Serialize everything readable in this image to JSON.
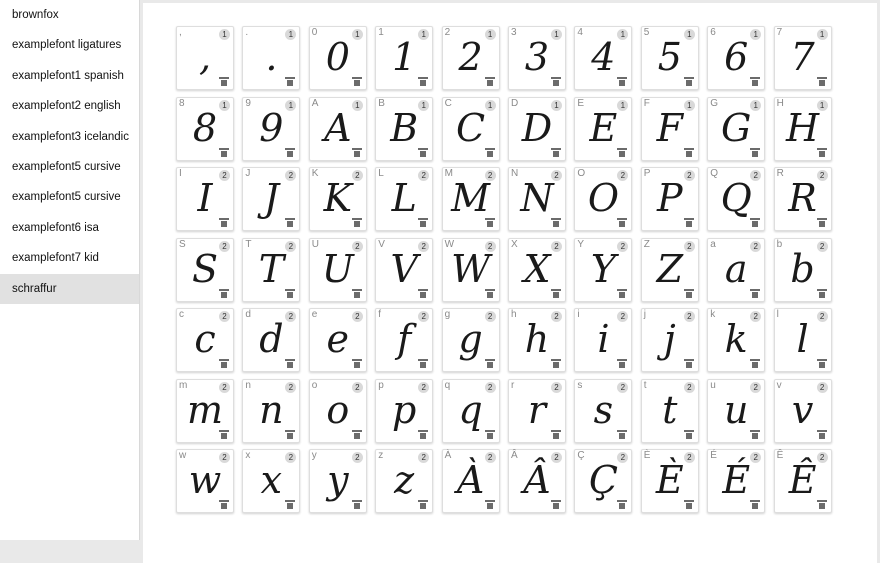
{
  "sidebar": {
    "items": [
      {
        "label": "brownfox",
        "selected": false
      },
      {
        "label": "examplefont ligatures",
        "selected": false
      },
      {
        "label": "examplefont1 spanish",
        "selected": false
      },
      {
        "label": "examplefont2 english",
        "selected": false
      },
      {
        "label": "examplefont3 icelandic",
        "selected": false
      },
      {
        "label": "examplefont5 cursive",
        "selected": false
      },
      {
        "label": "examplefont5 cursive",
        "selected": false
      },
      {
        "label": "examplefont6 isa",
        "selected": false
      },
      {
        "label": "examplefont7 kid",
        "selected": false
      },
      {
        "label": "schraffur",
        "selected": true
      }
    ]
  },
  "glyphs": [
    {
      "label": ",",
      "count": "1",
      "glyph": ","
    },
    {
      "label": ".",
      "count": "1",
      "glyph": "."
    },
    {
      "label": "0",
      "count": "1",
      "glyph": "0"
    },
    {
      "label": "1",
      "count": "1",
      "glyph": "1"
    },
    {
      "label": "2",
      "count": "1",
      "glyph": "2"
    },
    {
      "label": "3",
      "count": "1",
      "glyph": "3"
    },
    {
      "label": "4",
      "count": "1",
      "glyph": "4"
    },
    {
      "label": "5",
      "count": "1",
      "glyph": "5"
    },
    {
      "label": "6",
      "count": "1",
      "glyph": "6"
    },
    {
      "label": "7",
      "count": "1",
      "glyph": "7"
    },
    {
      "label": "8",
      "count": "1",
      "glyph": "8"
    },
    {
      "label": "9",
      "count": "1",
      "glyph": "9"
    },
    {
      "label": "A",
      "count": "1",
      "glyph": "A"
    },
    {
      "label": "B",
      "count": "1",
      "glyph": "B"
    },
    {
      "label": "C",
      "count": "1",
      "glyph": "C"
    },
    {
      "label": "D",
      "count": "1",
      "glyph": "D"
    },
    {
      "label": "E",
      "count": "1",
      "glyph": "E"
    },
    {
      "label": "F",
      "count": "1",
      "glyph": "F"
    },
    {
      "label": "G",
      "count": "1",
      "glyph": "G"
    },
    {
      "label": "H",
      "count": "1",
      "glyph": "H"
    },
    {
      "label": "I",
      "count": "2",
      "glyph": "I"
    },
    {
      "label": "J",
      "count": "2",
      "glyph": "J"
    },
    {
      "label": "K",
      "count": "2",
      "glyph": "K"
    },
    {
      "label": "L",
      "count": "2",
      "glyph": "L"
    },
    {
      "label": "M",
      "count": "2",
      "glyph": "M"
    },
    {
      "label": "N",
      "count": "2",
      "glyph": "N"
    },
    {
      "label": "O",
      "count": "2",
      "glyph": "O"
    },
    {
      "label": "P",
      "count": "2",
      "glyph": "P"
    },
    {
      "label": "Q",
      "count": "2",
      "glyph": "Q"
    },
    {
      "label": "R",
      "count": "2",
      "glyph": "R"
    },
    {
      "label": "S",
      "count": "2",
      "glyph": "S"
    },
    {
      "label": "T",
      "count": "2",
      "glyph": "T"
    },
    {
      "label": "U",
      "count": "2",
      "glyph": "U"
    },
    {
      "label": "V",
      "count": "2",
      "glyph": "V"
    },
    {
      "label": "W",
      "count": "2",
      "glyph": "W"
    },
    {
      "label": "X",
      "count": "2",
      "glyph": "X"
    },
    {
      "label": "Y",
      "count": "2",
      "glyph": "Y"
    },
    {
      "label": "Z",
      "count": "2",
      "glyph": "Z"
    },
    {
      "label": "a",
      "count": "2",
      "glyph": "a"
    },
    {
      "label": "b",
      "count": "2",
      "glyph": "b"
    },
    {
      "label": "c",
      "count": "2",
      "glyph": "c"
    },
    {
      "label": "d",
      "count": "2",
      "glyph": "d"
    },
    {
      "label": "e",
      "count": "2",
      "glyph": "e"
    },
    {
      "label": "f",
      "count": "2",
      "glyph": "f"
    },
    {
      "label": "g",
      "count": "2",
      "glyph": "g"
    },
    {
      "label": "h",
      "count": "2",
      "glyph": "h"
    },
    {
      "label": "i",
      "count": "2",
      "glyph": "i"
    },
    {
      "label": "j",
      "count": "2",
      "glyph": "j"
    },
    {
      "label": "k",
      "count": "2",
      "glyph": "k"
    },
    {
      "label": "l",
      "count": "2",
      "glyph": "l"
    },
    {
      "label": "m",
      "count": "2",
      "glyph": "m"
    },
    {
      "label": "n",
      "count": "2",
      "glyph": "n"
    },
    {
      "label": "o",
      "count": "2",
      "glyph": "o"
    },
    {
      "label": "p",
      "count": "2",
      "glyph": "p"
    },
    {
      "label": "q",
      "count": "2",
      "glyph": "q"
    },
    {
      "label": "r",
      "count": "2",
      "glyph": "r"
    },
    {
      "label": "s",
      "count": "2",
      "glyph": "s"
    },
    {
      "label": "t",
      "count": "2",
      "glyph": "t"
    },
    {
      "label": "u",
      "count": "2",
      "glyph": "u"
    },
    {
      "label": "v",
      "count": "2",
      "glyph": "v"
    },
    {
      "label": "w",
      "count": "2",
      "glyph": "w"
    },
    {
      "label": "x",
      "count": "2",
      "glyph": "x"
    },
    {
      "label": "y",
      "count": "2",
      "glyph": "y"
    },
    {
      "label": "z",
      "count": "2",
      "glyph": "z"
    },
    {
      "label": "À",
      "count": "2",
      "glyph": "À"
    },
    {
      "label": "Â",
      "count": "2",
      "glyph": "Â"
    },
    {
      "label": "Ç",
      "count": "2",
      "glyph": "Ç"
    },
    {
      "label": "È",
      "count": "2",
      "glyph": "È"
    },
    {
      "label": "É",
      "count": "2",
      "glyph": "É"
    },
    {
      "label": "Ê",
      "count": "2",
      "glyph": "Ê"
    }
  ]
}
